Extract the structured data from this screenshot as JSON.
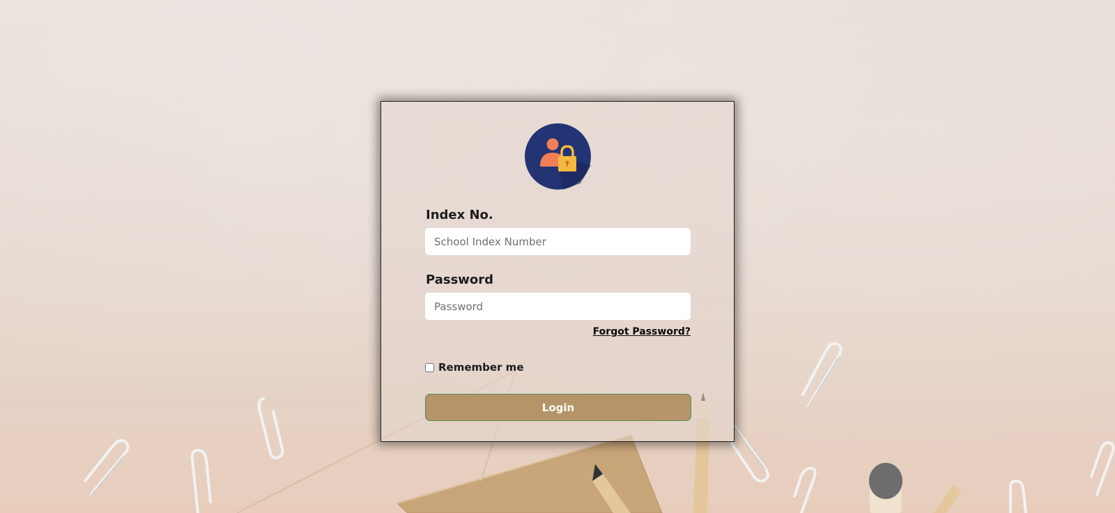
{
  "login": {
    "avatar_icon": "user-lock-icon",
    "index_label": "Index No.",
    "index_placeholder": "School Index Number",
    "index_value": "",
    "password_label": "Password",
    "password_placeholder": "Password",
    "password_value": "",
    "forgot_label": "Forgot Password?",
    "remember_label": "Remember me",
    "remember_checked": false,
    "login_label": "Login"
  },
  "colors": {
    "button_bg": "#b49468",
    "button_border": "#5b8a55",
    "avatar_bg": "#233474",
    "avatar_person": "#f07f55",
    "avatar_lock": "#f6b940"
  }
}
